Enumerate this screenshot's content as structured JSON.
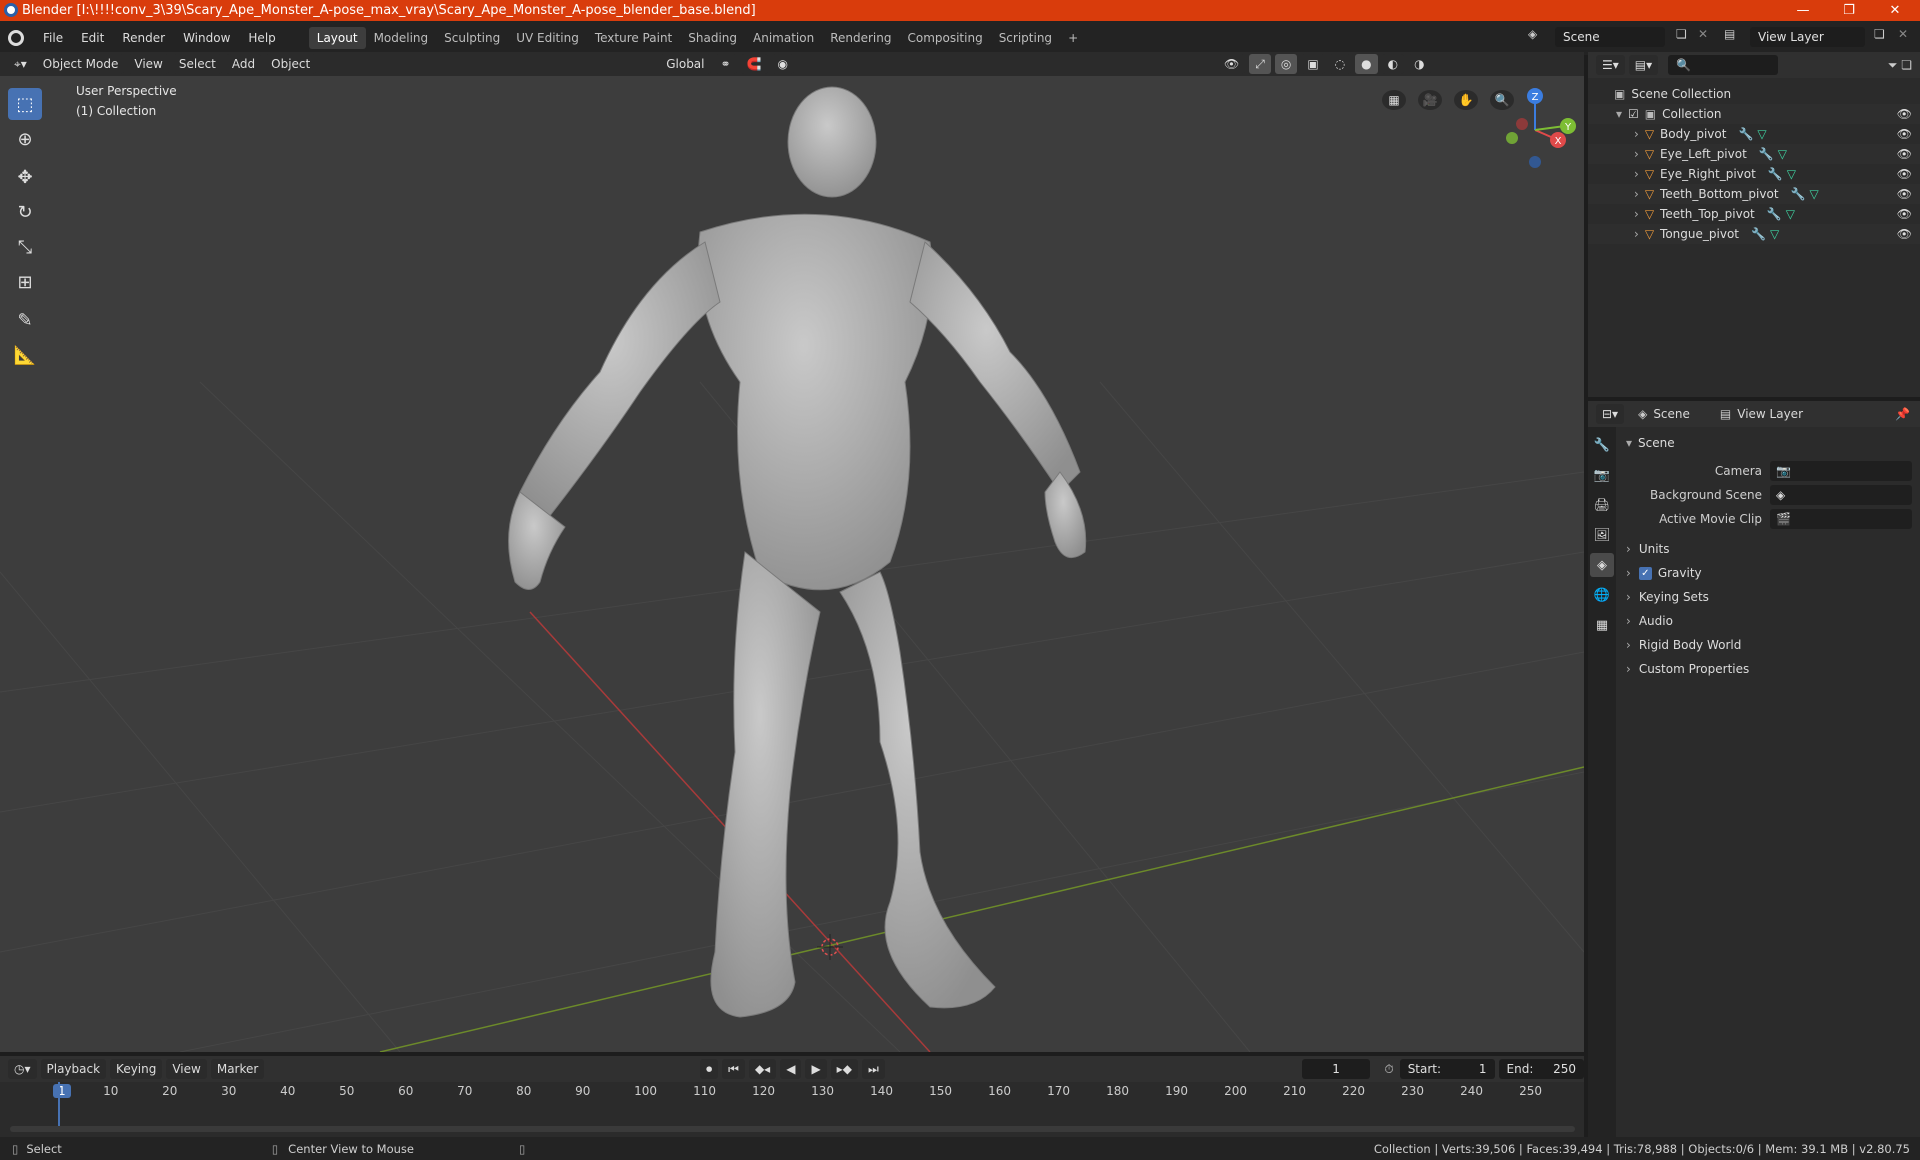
{
  "window": {
    "title": "Blender [I:\\!!!!conv_3\\39\\Scary_Ape_Monster_A-pose_max_vray\\Scary_Ape_Monster_A-pose_blender_base.blend]",
    "controls": [
      "—",
      "❐",
      "✕"
    ]
  },
  "menubar": {
    "menus": [
      "File",
      "Edit",
      "Render",
      "Window",
      "Help"
    ],
    "workspaces": [
      "Layout",
      "Modeling",
      "Sculpting",
      "UV Editing",
      "Texture Paint",
      "Shading",
      "Animation",
      "Rendering",
      "Compositing",
      "Scripting"
    ],
    "active_workspace": "Layout",
    "add_workspace": "+",
    "scene": "Scene",
    "view_layer": "View Layer"
  },
  "viewport_header": {
    "mode": "Object Mode",
    "menus": [
      "View",
      "Select",
      "Add",
      "Object"
    ],
    "orientation": "Global"
  },
  "viewport": {
    "perspective_label": "User Perspective",
    "collection_label": "(1) Collection",
    "gizmo": {
      "z": "Z",
      "y": "Y",
      "x": "X"
    }
  },
  "toolbar": {
    "tools": [
      "select-box",
      "cursor",
      "move",
      "rotate",
      "scale",
      "transform",
      "annotate",
      "measure"
    ]
  },
  "outliner": {
    "root": "Scene Collection",
    "collection": "Collection",
    "items": [
      "Body_pivot",
      "Eye_Left_pivot",
      "Eye_Right_pivot",
      "Teeth_Bottom_pivot",
      "Teeth_Top_pivot",
      "Tongue_pivot"
    ]
  },
  "properties": {
    "tabs_header": {
      "scene": "Scene",
      "view_layer": "View Layer"
    },
    "section_title": "Scene",
    "fields": [
      {
        "label": "Camera",
        "value": ""
      },
      {
        "label": "Background Scene",
        "value": ""
      },
      {
        "label": "Active Movie Clip",
        "value": ""
      }
    ],
    "panels": [
      "Units",
      "Gravity",
      "Keying Sets",
      "Audio",
      "Rigid Body World",
      "Custom Properties"
    ],
    "gravity_checked": true
  },
  "timeline": {
    "menus": [
      "Playback",
      "Keying",
      "View",
      "Marker"
    ],
    "current_frame": "1",
    "start_label": "Start:",
    "start": "1",
    "end_label": "End:",
    "end": "250",
    "ticks": [
      "1",
      "10",
      "20",
      "30",
      "40",
      "50",
      "60",
      "70",
      "80",
      "90",
      "100",
      "110",
      "120",
      "130",
      "140",
      "150",
      "160",
      "170",
      "180",
      "190",
      "200",
      "210",
      "220",
      "230",
      "240",
      "250"
    ]
  },
  "statusbar": {
    "left": "Select",
    "middle": "Center View to Mouse",
    "right": "Collection | Verts:39,506 | Faces:39,494 | Tris:78,988 | Objects:0/6 | Mem: 39.1 MB | v2.80.75"
  },
  "colors": {
    "titlebar": "#d93c0c",
    "accent": "#4772b3",
    "object_icon": "#e8973a",
    "modifier_icon": "#6ea8e8",
    "mesh_icon": "#3fd1a0"
  }
}
